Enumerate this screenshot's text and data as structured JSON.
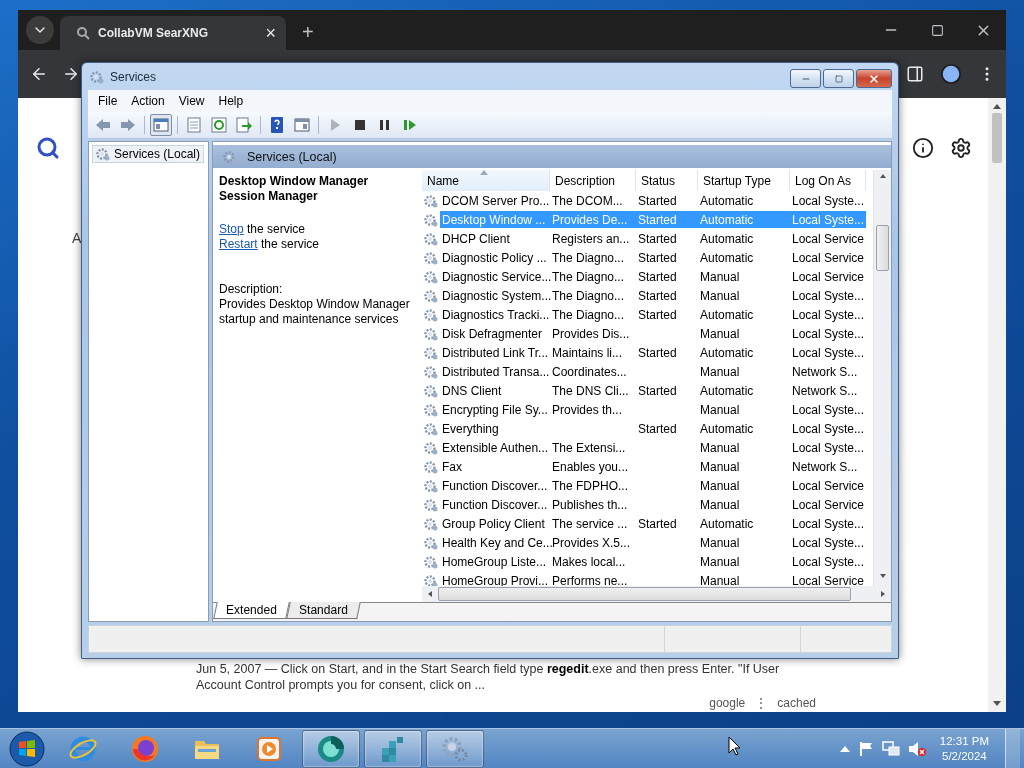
{
  "browser": {
    "tab_title": "CollabVM SearXNG",
    "tab_close": "×",
    "new_tab": "+",
    "page": {
      "tab_fragment": "A",
      "snippet": "Jun 5, 2007 — Click on Start, and in the Start Search field type **regedit**.exe and then press Enter. \"If User Account Control prompts you for consent, click on ...",
      "links": [
        "google",
        "cached"
      ],
      "separator": "⋮"
    }
  },
  "services": {
    "title": "Services",
    "menu": [
      "File",
      "Action",
      "View",
      "Help"
    ],
    "toolbar": [
      {
        "kind": "back",
        "disabled": false,
        "pressed": false
      },
      {
        "kind": "forward",
        "disabled": false,
        "pressed": false
      },
      {
        "kind": "tree",
        "disabled": false,
        "pressed": true
      },
      {
        "kind": "properties",
        "disabled": false,
        "pressed": false
      },
      {
        "kind": "refresh",
        "disabled": false,
        "pressed": false
      },
      {
        "kind": "export",
        "disabled": false,
        "pressed": false
      },
      {
        "kind": "help",
        "disabled": false,
        "pressed": false
      },
      {
        "kind": "panel",
        "disabled": false,
        "pressed": false
      },
      {
        "kind": "play",
        "disabled": true,
        "pressed": false
      },
      {
        "kind": "stop",
        "disabled": false,
        "pressed": false
      },
      {
        "kind": "pause",
        "disabled": false,
        "pressed": false
      },
      {
        "kind": "resume",
        "disabled": false,
        "pressed": false
      }
    ],
    "tree": [
      {
        "label": "Services (Local)",
        "selected": true
      }
    ],
    "header": "Services (Local)",
    "detail": {
      "title": "Desktop Window Manager Session Manager",
      "actions": [
        {
          "link": "Stop",
          "text": " the service"
        },
        {
          "link": "Restart",
          "text": " the service"
        }
      ],
      "description_label": "Description:",
      "description": "Provides Desktop Window Manager startup and maintenance services"
    },
    "columns": [
      "Name",
      "Description",
      "Status",
      "Startup Type",
      "Log On As"
    ],
    "rows": [
      {
        "name": "DCOM Server Pro...",
        "description": "The DCOM...",
        "status": "Started",
        "startup": "Automatic",
        "logon": "Local Syste...",
        "selected": false
      },
      {
        "name": "Desktop Window ...",
        "description": "Provides De...",
        "status": "Started",
        "startup": "Automatic",
        "logon": "Local Syste...",
        "selected": true
      },
      {
        "name": "DHCP Client",
        "description": "Registers an...",
        "status": "Started",
        "startup": "Automatic",
        "logon": "Local Service",
        "selected": false
      },
      {
        "name": "Diagnostic Policy ...",
        "description": "The Diagno...",
        "status": "Started",
        "startup": "Automatic",
        "logon": "Local Service",
        "selected": false
      },
      {
        "name": "Diagnostic Service...",
        "description": "The Diagno...",
        "status": "Started",
        "startup": "Manual",
        "logon": "Local Service",
        "selected": false
      },
      {
        "name": "Diagnostic System...",
        "description": "The Diagno...",
        "status": "Started",
        "startup": "Manual",
        "logon": "Local Syste...",
        "selected": false
      },
      {
        "name": "Diagnostics Tracki...",
        "description": "The Diagno...",
        "status": "Started",
        "startup": "Automatic",
        "logon": "Local Syste...",
        "selected": false
      },
      {
        "name": "Disk Defragmenter",
        "description": "Provides Dis...",
        "startup": "Manual",
        "logon": "Local Syste...",
        "selected": false
      },
      {
        "name": "Distributed Link Tr...",
        "description": "Maintains li...",
        "status": "Started",
        "startup": "Automatic",
        "logon": "Local Syste...",
        "selected": false
      },
      {
        "name": "Distributed Transa...",
        "description": "Coordinates...",
        "startup": "Manual",
        "logon": "Network S...",
        "selected": false
      },
      {
        "name": "DNS Client",
        "description": "The DNS Cli...",
        "status": "Started",
        "startup": "Automatic",
        "logon": "Network S...",
        "selected": false
      },
      {
        "name": "Encrypting File Sy...",
        "description": "Provides th...",
        "startup": "Manual",
        "logon": "Local Syste...",
        "selected": false
      },
      {
        "name": "Everything",
        "status": "Started",
        "startup": "Automatic",
        "logon": "Local Syste...",
        "selected": false
      },
      {
        "name": "Extensible Authen...",
        "description": "The Extensi...",
        "startup": "Manual",
        "logon": "Local Syste...",
        "selected": false
      },
      {
        "name": "Fax",
        "description": "Enables you...",
        "startup": "Manual",
        "logon": "Network S...",
        "selected": false
      },
      {
        "name": "Function Discover...",
        "description": "The FDPHO...",
        "startup": "Manual",
        "logon": "Local Service",
        "selected": false
      },
      {
        "name": "Function Discover...",
        "description": "Publishes th...",
        "startup": "Manual",
        "logon": "Local Service",
        "selected": false
      },
      {
        "name": "Group Policy Client",
        "description": "The service ...",
        "status": "Started",
        "startup": "Automatic",
        "logon": "Local Syste...",
        "selected": false
      },
      {
        "name": "Health Key and Ce...",
        "description": "Provides X.5...",
        "startup": "Manual",
        "logon": "Local Syste...",
        "selected": false
      },
      {
        "name": "HomeGroup Liste...",
        "description": "Makes local...",
        "startup": "Manual",
        "logon": "Local Syste...",
        "selected": false
      },
      {
        "name": "HomeGroup Provi...",
        "description": "Performs ne...",
        "startup": "Manual",
        "logon": "Local Service",
        "selected": false
      }
    ],
    "tabs": [
      {
        "label": "Extended",
        "selected": true
      },
      {
        "label": "Standard",
        "selected": false
      }
    ]
  },
  "taskbar": {
    "apps": [
      {
        "kind": "ie",
        "running": false
      },
      {
        "kind": "firefox",
        "running": false
      },
      {
        "kind": "explorer",
        "running": false
      },
      {
        "kind": "media",
        "running": false
      },
      {
        "kind": "ring",
        "running": true
      },
      {
        "kind": "registry",
        "running": true
      },
      {
        "kind": "services",
        "running": true
      }
    ],
    "clock": {
      "time": "12:31 PM",
      "date": "5/2/2024"
    }
  }
}
